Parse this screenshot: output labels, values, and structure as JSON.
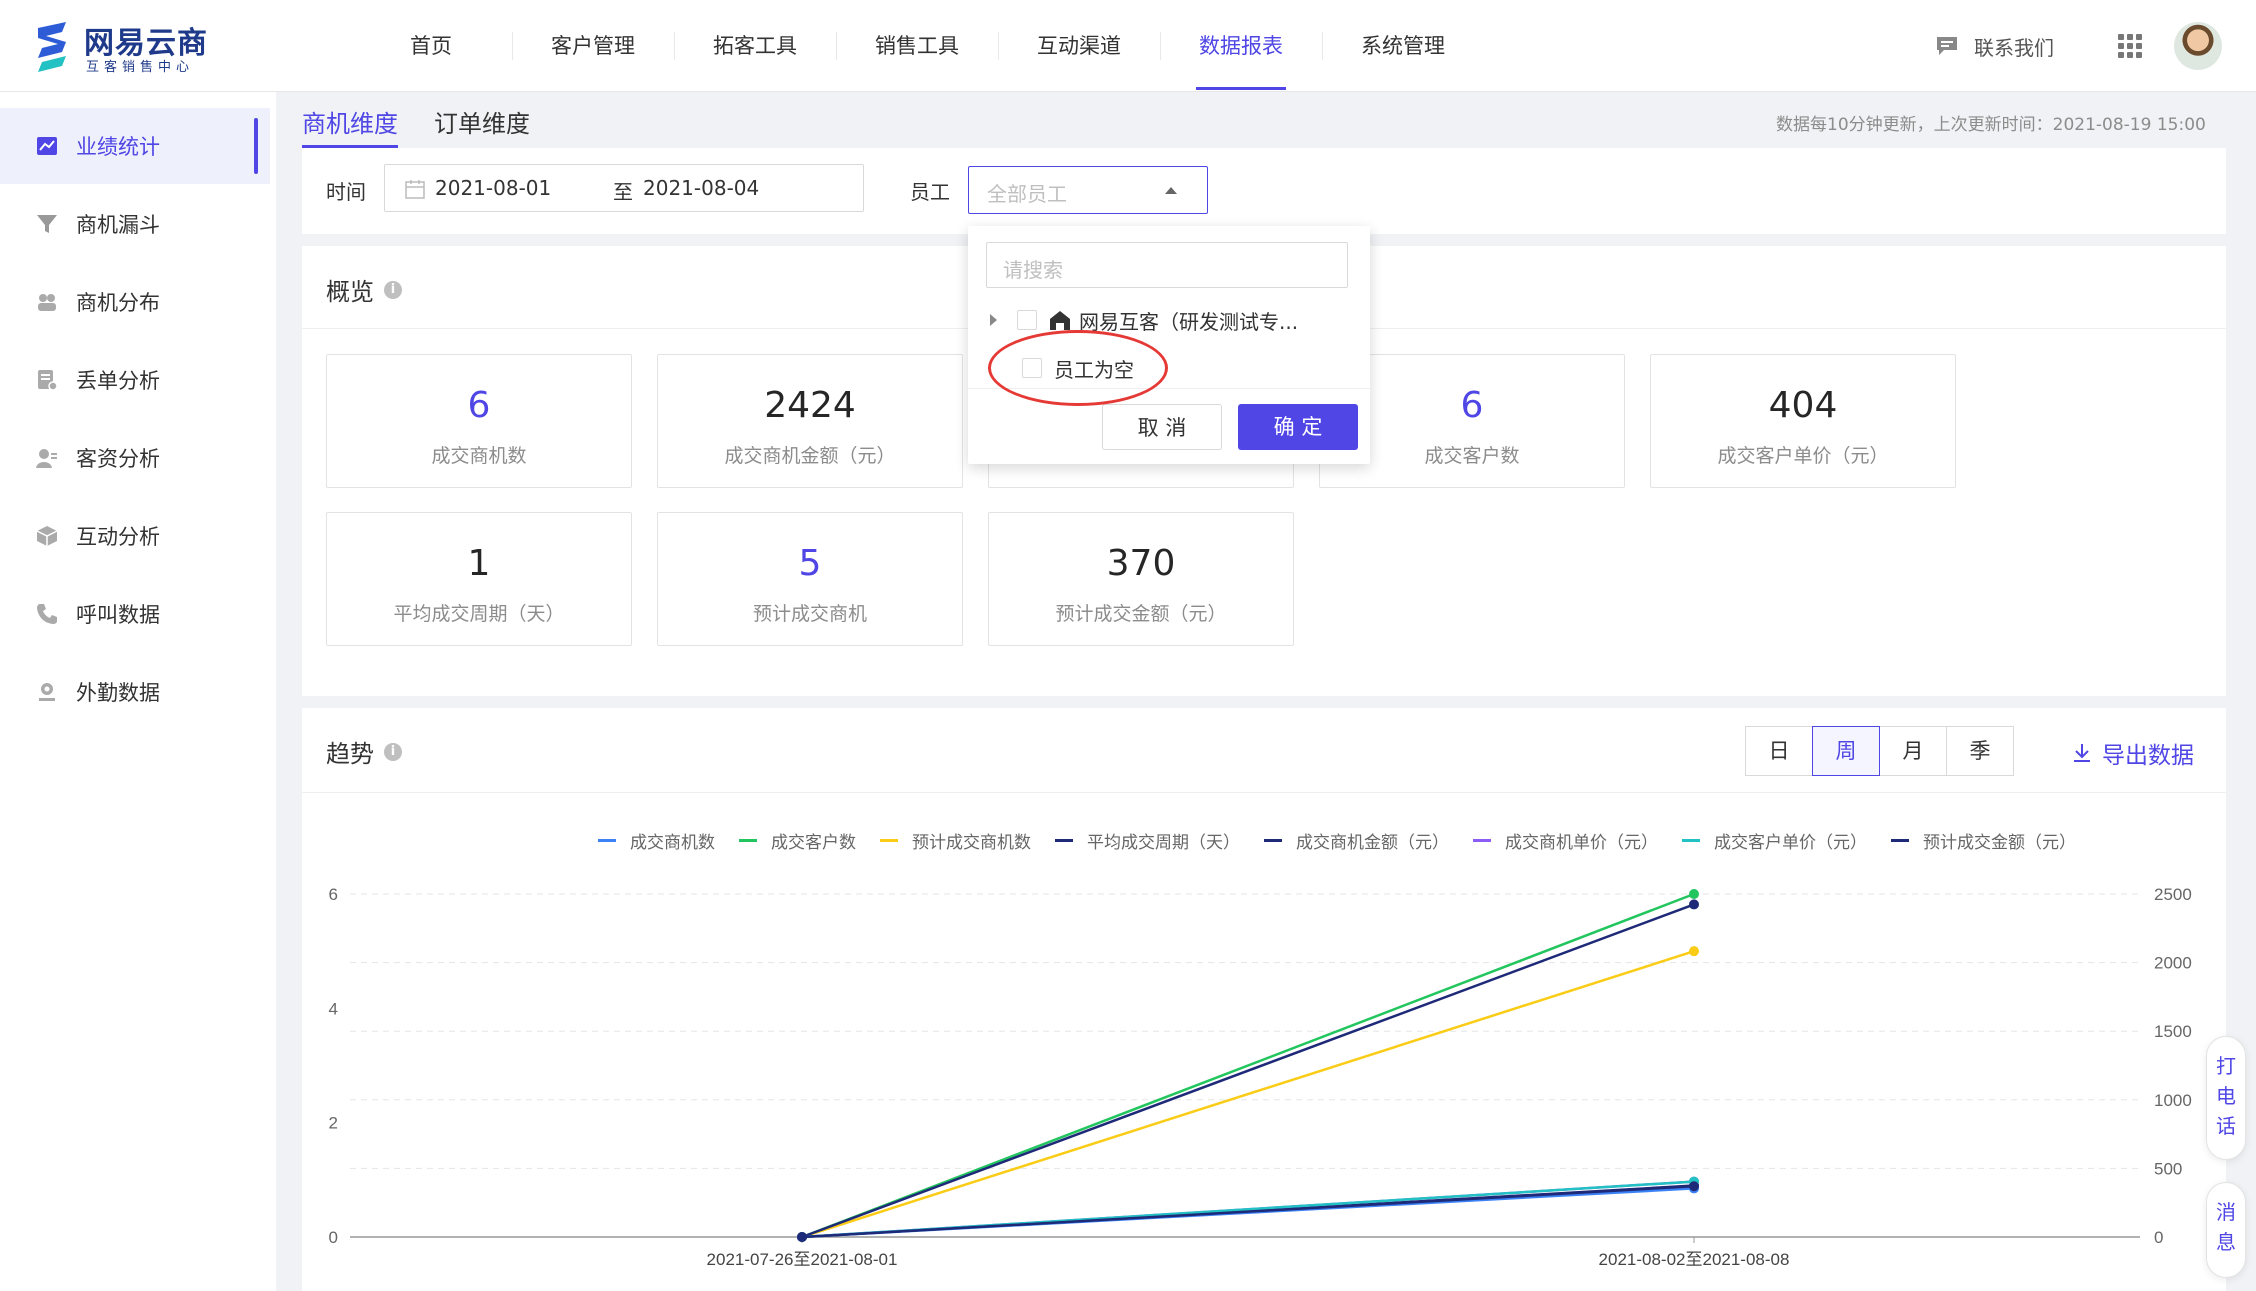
{
  "app": {
    "logo_title": "网易云商",
    "logo_sub": "互客销售中心"
  },
  "nav": [
    "首页",
    "客户管理",
    "拓客工具",
    "销售工具",
    "互动渠道",
    "数据报表",
    "系统管理"
  ],
  "nav_active": "数据报表",
  "header": {
    "contact": "联系我们"
  },
  "sidebar": {
    "items": [
      {
        "label": "业绩统计",
        "icon": "trend-chart-icon"
      },
      {
        "label": "商机漏斗",
        "icon": "funnel-icon"
      },
      {
        "label": "商机分布",
        "icon": "distribution-icon"
      },
      {
        "label": "丢单分析",
        "icon": "lost-order-icon"
      },
      {
        "label": "客资分析",
        "icon": "customer-icon"
      },
      {
        "label": "互动分析",
        "icon": "interaction-icon"
      },
      {
        "label": "呼叫数据",
        "icon": "phone-icon"
      },
      {
        "label": "外勤数据",
        "icon": "location-icon"
      }
    ]
  },
  "tabs": [
    "商机维度",
    "订单维度"
  ],
  "update_note": "数据每10分钟更新，上次更新时间：2021-08-19 15:00",
  "filter": {
    "time_label": "时间",
    "date_from": "2021-08-01",
    "date_sep": "至",
    "date_to": "2021-08-04",
    "employee_label": "员工",
    "employee_placeholder": "全部员工"
  },
  "dropdown": {
    "search_placeholder": "请搜索",
    "org_node": "网易互客（研发测试专...",
    "empty_employee": "员工为空",
    "cancel": "取 消",
    "confirm": "确 定"
  },
  "overview": {
    "title": "概览",
    "row1": [
      {
        "value": "6",
        "label": "成交商机数",
        "blue": true
      },
      {
        "value": "2424",
        "label": "成交商机金额（元）",
        "blue": false
      },
      {
        "value": "",
        "label": "",
        "blue": false
      },
      {
        "value": "6",
        "label": "成交客户数",
        "blue": true
      },
      {
        "value": "404",
        "label": "成交客户单价（元）",
        "blue": false
      }
    ],
    "row2": [
      {
        "value": "1",
        "label": "平均成交周期（天）",
        "blue": false
      },
      {
        "value": "5",
        "label": "预计成交商机",
        "blue": true
      },
      {
        "value": "370",
        "label": "预计成交金额（元）",
        "blue": false
      }
    ]
  },
  "trend": {
    "title": "趋势",
    "periods": [
      "日",
      "周",
      "月",
      "季"
    ],
    "active_period": "周",
    "export": "导出数据"
  },
  "float_buttons": {
    "call": [
      "打",
      "电",
      "话"
    ],
    "message": [
      "消",
      "息"
    ]
  },
  "colors": {
    "accent": "#4f46e5",
    "highlight_ring": "#e53935"
  },
  "chart_data": {
    "type": "line",
    "x": [
      "2021-07-26至2021-08-01",
      "2021-08-02至2021-08-08"
    ],
    "y_left_ticks": [
      "0",
      "2",
      "4",
      "6"
    ],
    "y_right_ticks": [
      "0",
      "500",
      "1000",
      "1500",
      "2000",
      "2500"
    ],
    "ylim_left": [
      0,
      6
    ],
    "ylim_right": [
      0,
      2500
    ],
    "grid": true,
    "legend_position": "top",
    "series": [
      {
        "name": "成交商机数",
        "color": "#3b82f6",
        "axis": "left",
        "values": [
          0,
          0.85
        ]
      },
      {
        "name": "成交客户数",
        "color": "#22c55e",
        "axis": "left",
        "values": [
          0,
          6
        ]
      },
      {
        "name": "预计成交商机数",
        "color": "#facc15",
        "axis": "left",
        "values": [
          0,
          5
        ]
      },
      {
        "name": "平均成交周期（天）",
        "color": "#1e2a78",
        "axis": "left",
        "values": [
          0,
          0.9
        ]
      },
      {
        "name": "成交商机金额（元）",
        "color": "#1e2a78",
        "axis": "right",
        "values": [
          0,
          2424
        ]
      },
      {
        "name": "成交商机单价（元）",
        "color": "#8b5cf6",
        "axis": "right",
        "values": [
          0,
          404
        ]
      },
      {
        "name": "成交客户单价（元）",
        "color": "#22c1c3",
        "axis": "right",
        "values": [
          0,
          404
        ]
      },
      {
        "name": "预计成交金额（元）",
        "color": "#1e2a78",
        "axis": "right",
        "values": [
          0,
          370
        ]
      }
    ]
  }
}
